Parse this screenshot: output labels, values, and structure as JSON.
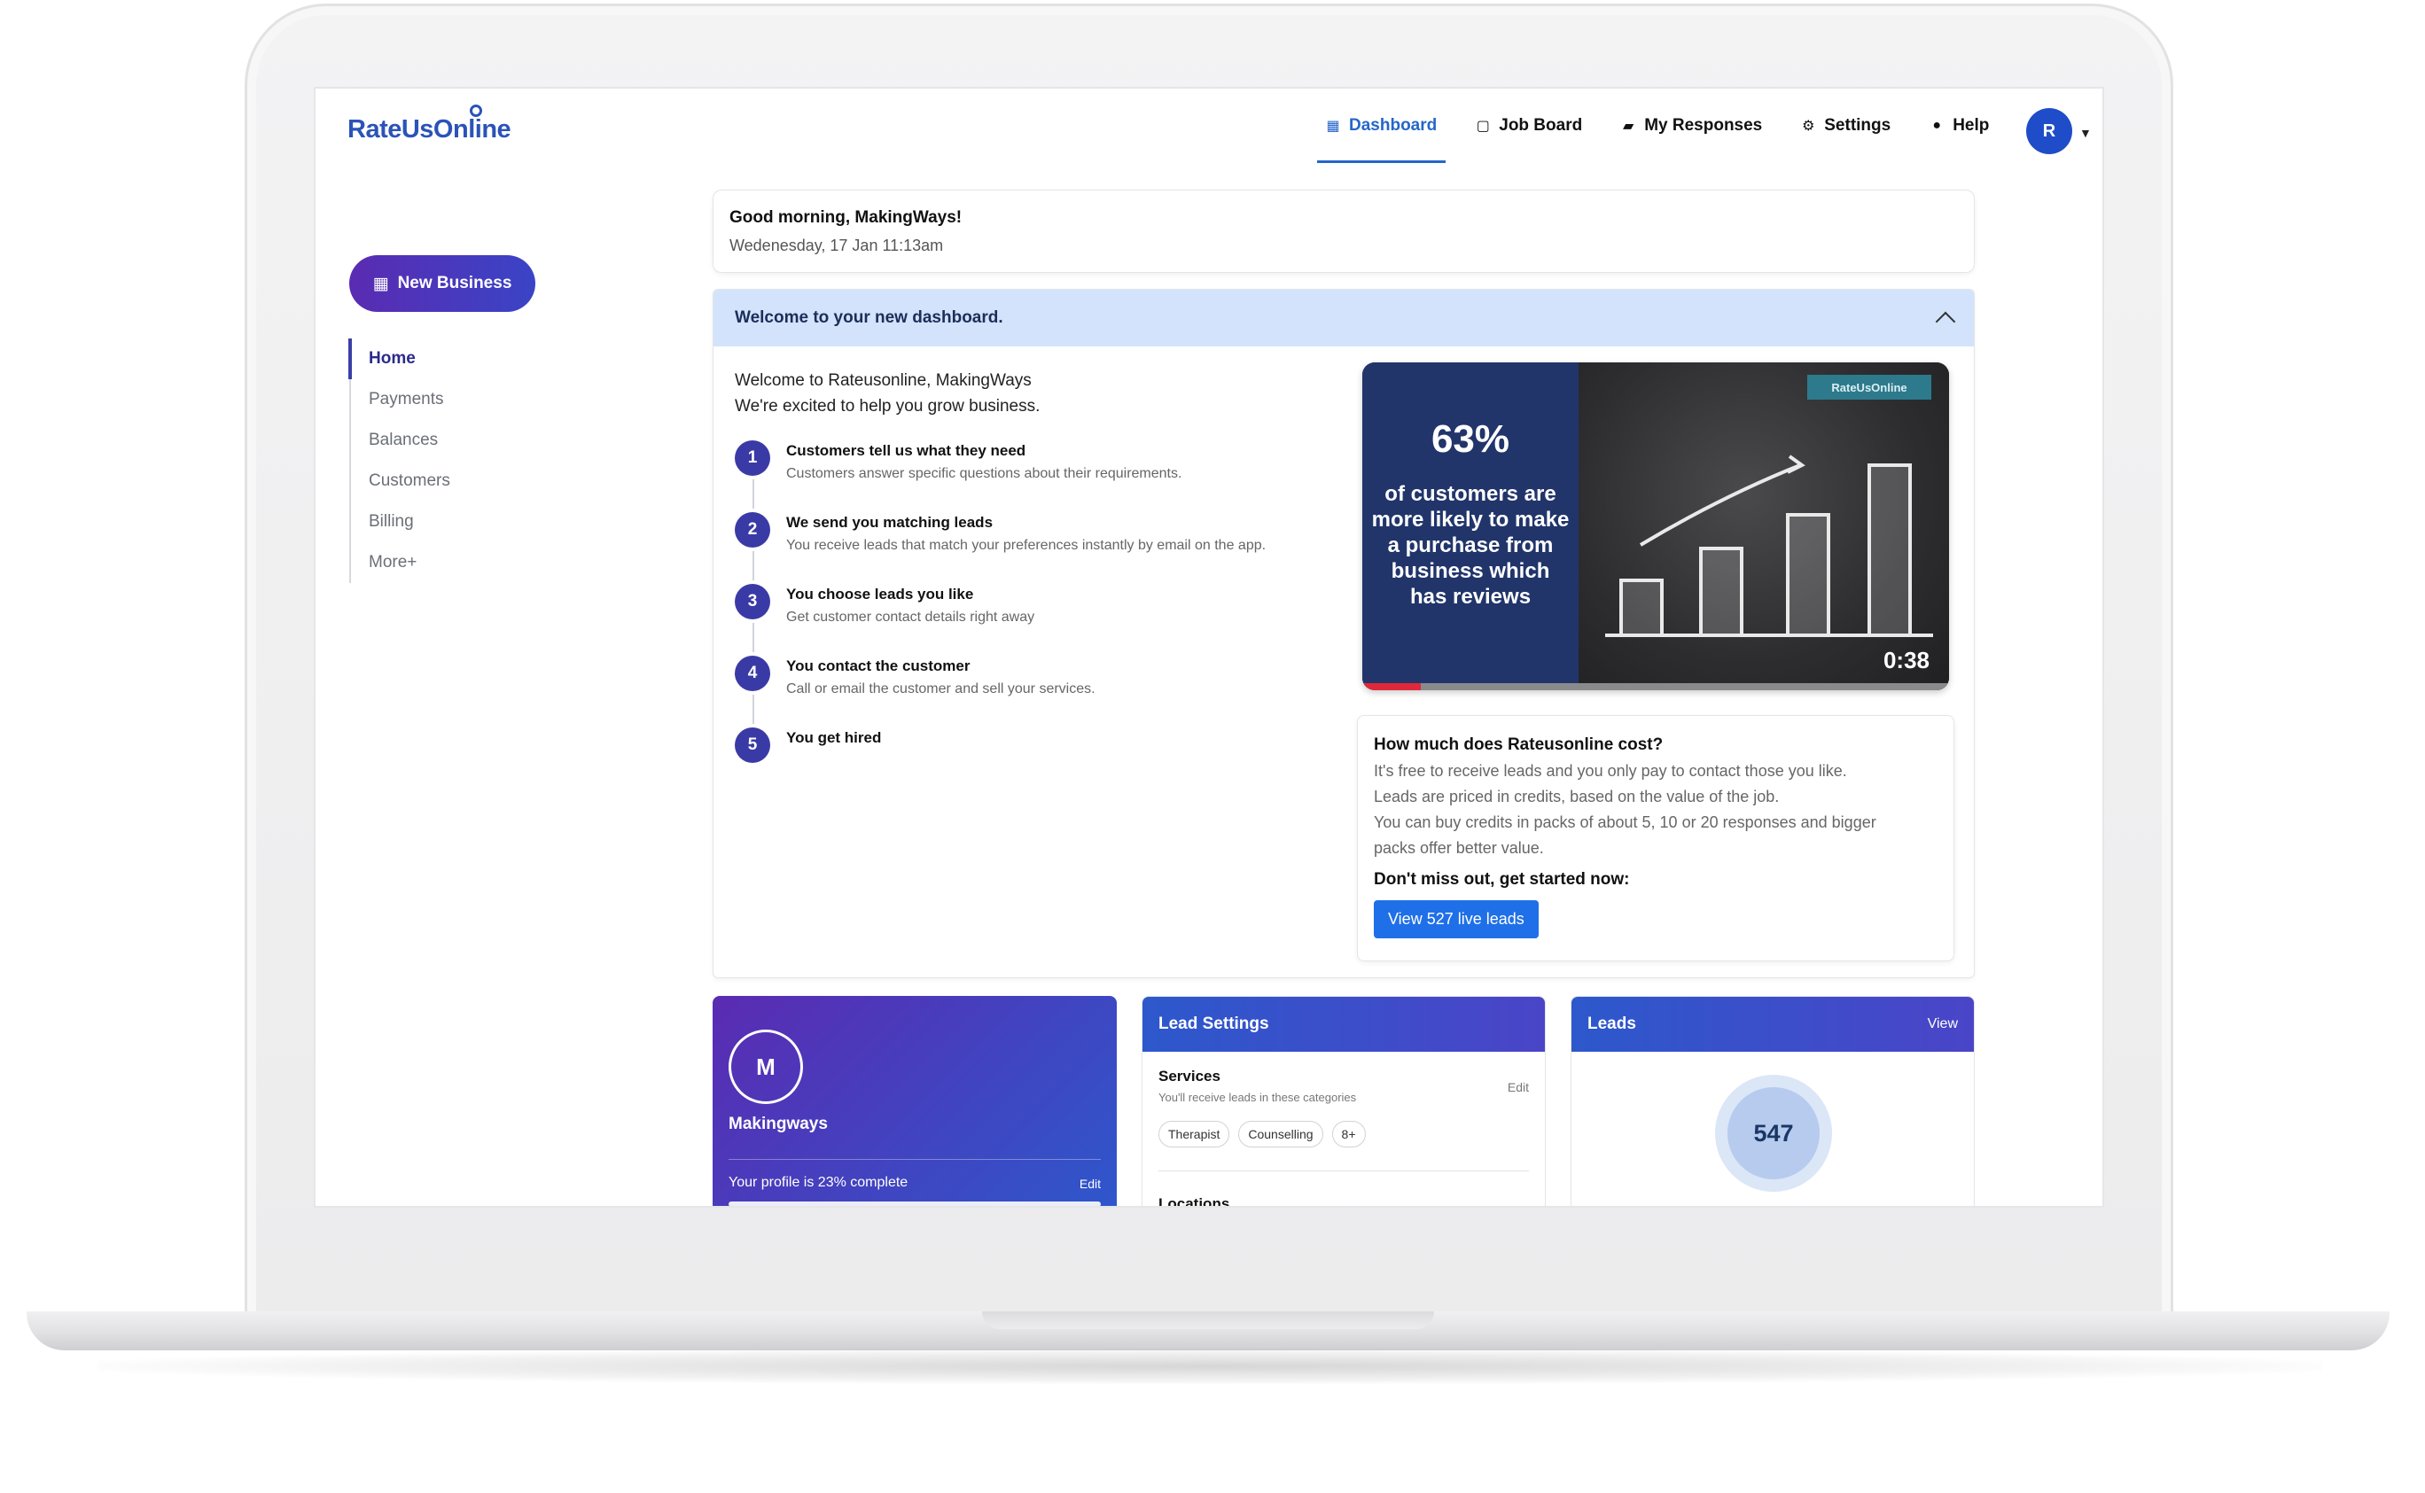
{
  "brand": {
    "name": "RateUsOnline",
    "color": "#2b53b8"
  },
  "nav": {
    "items": [
      {
        "label": "Dashboard",
        "icon": "grid-icon",
        "active": true
      },
      {
        "label": "Job Board",
        "icon": "clipboard-icon"
      },
      {
        "label": "My Responses",
        "icon": "chat-icon"
      },
      {
        "label": "Settings",
        "icon": "gear-icon"
      },
      {
        "label": "Help",
        "icon": "question-icon"
      }
    ],
    "avatar_initial": "R"
  },
  "sidebar": {
    "new_business_label": "New Business",
    "items": [
      {
        "label": "Home",
        "active": true
      },
      {
        "label": "Payments"
      },
      {
        "label": "Balances"
      },
      {
        "label": "Customers"
      },
      {
        "label": "Billing"
      },
      {
        "label": "More+"
      }
    ]
  },
  "greeting": {
    "title": "Good morning, MakingWays!",
    "date": "Wedenesday, 17 Jan 11:13am"
  },
  "welcome": {
    "header": "Welcome to your new dashboard.",
    "intro_line1": "Welcome to Rateusonline, MakingWays",
    "intro_line2": "We're excited to help you grow business.",
    "steps": [
      {
        "num": "1",
        "title": "Customers tell us what they need",
        "desc": "Customers answer specific questions about their requirements."
      },
      {
        "num": "2",
        "title": "We send you matching leads",
        "desc": "You receive leads that match your preferences instantly by email on the app."
      },
      {
        "num": "3",
        "title": "You choose leads you like",
        "desc": "Get customer contact details right away"
      },
      {
        "num": "4",
        "title": "You contact the customer",
        "desc": "Call or email the customer and sell your services."
      },
      {
        "num": "5",
        "title": "You get hired",
        "desc": ""
      }
    ]
  },
  "video": {
    "percent": "63%",
    "caption": "of customers are more likely to make a purchase from business which has reviews",
    "badge": "RateUsOnline",
    "duration": "0:38",
    "progress": 0.1
  },
  "cost": {
    "title": "How much does Rateusonline cost?",
    "lines": [
      "It's free to receive leads and you only pay to contact those you like.",
      "Leads are priced in credits, based on the value of the job.",
      "You can buy credits in packs of about 5, 10 or 20 responses and bigger",
      "packs offer better value."
    ],
    "cta_title": "Don't miss out, get started now:",
    "cta_button": "View 527 live leads"
  },
  "profile_card": {
    "initial": "M",
    "name": "Makingways",
    "complete_text": "Your profile is 23% complete",
    "edit": "Edit",
    "progress": 0.23
  },
  "lead_settings": {
    "title": "Lead Settings",
    "services_title": "Services",
    "services_sub": "You'll receive leads in these categories",
    "edit": "Edit",
    "chips": [
      "Therapist",
      "Counselling",
      "8+"
    ],
    "locations_title": "Locations"
  },
  "leads_card": {
    "title": "Leads",
    "view": "View",
    "count": "547"
  }
}
